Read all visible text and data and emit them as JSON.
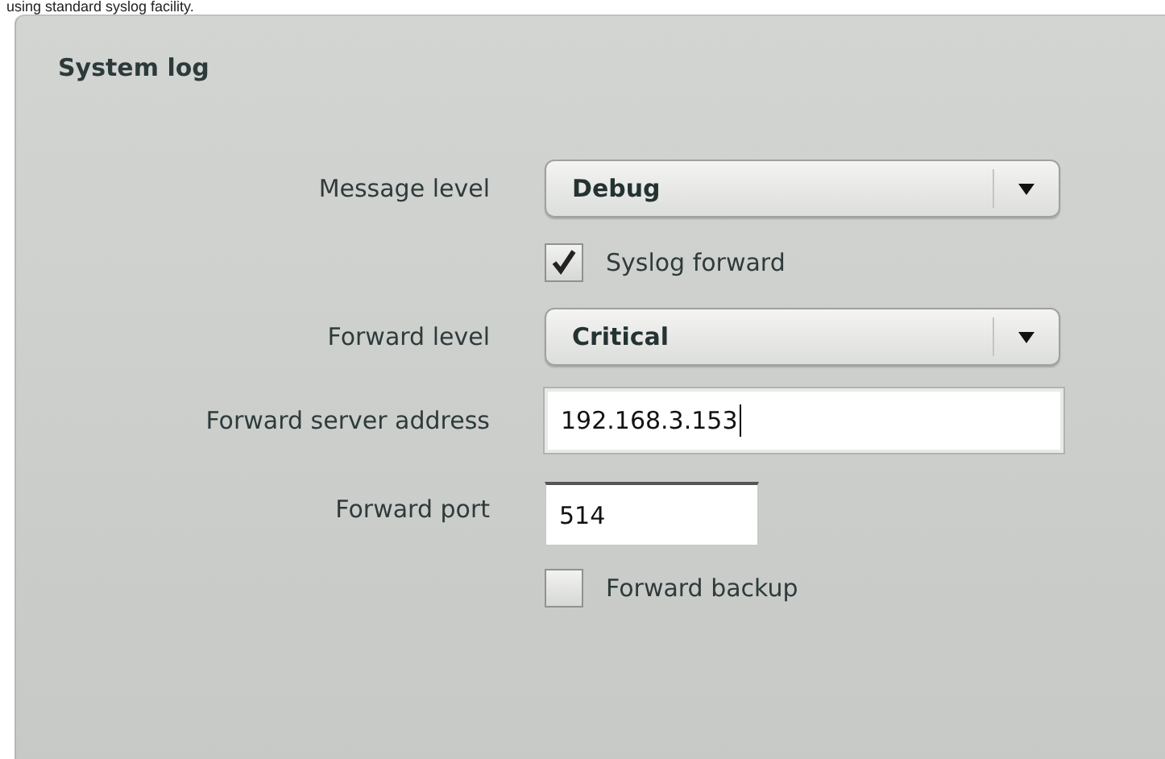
{
  "intro_text": "using standard syslog facility.",
  "panel": {
    "title": "System log",
    "rows": [
      {
        "kind": "select",
        "label": "Message level",
        "value": "Debug"
      },
      {
        "kind": "checkbox",
        "label": "Syslog forward",
        "checked": true
      },
      {
        "kind": "select",
        "label": "Forward level",
        "value": "Critical"
      },
      {
        "kind": "input",
        "label": "Forward server address",
        "value": "192.168.3.153",
        "focused": true,
        "wide": true
      },
      {
        "kind": "input",
        "label": "Forward port",
        "value": "514",
        "focused": false,
        "wide": false
      },
      {
        "kind": "checkbox",
        "label": "Forward backup",
        "checked": false
      }
    ]
  }
}
